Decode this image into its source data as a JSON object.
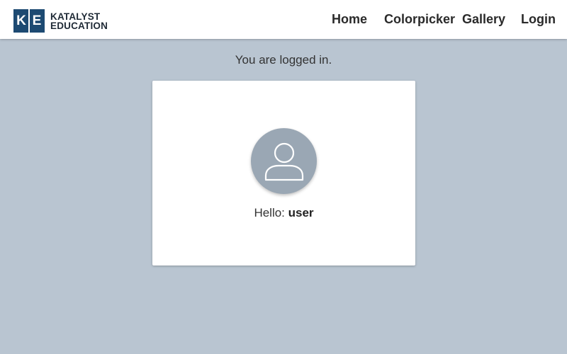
{
  "brand": {
    "mark_left": "K",
    "mark_right": "E",
    "line1": "KATALYST",
    "line2": "EDUCATION"
  },
  "nav": {
    "home": "Home",
    "colorpicker": "Colorpicker",
    "gallery": "Gallery",
    "login": "Login"
  },
  "status": "You are logged in.",
  "profile": {
    "avatar_icon": "user-icon",
    "greeting_label": "Hello:",
    "username": "user"
  },
  "colors": {
    "brand": "#1d4a72",
    "page_background": "#b9c5d1",
    "avatar": "#9aa7b4"
  }
}
